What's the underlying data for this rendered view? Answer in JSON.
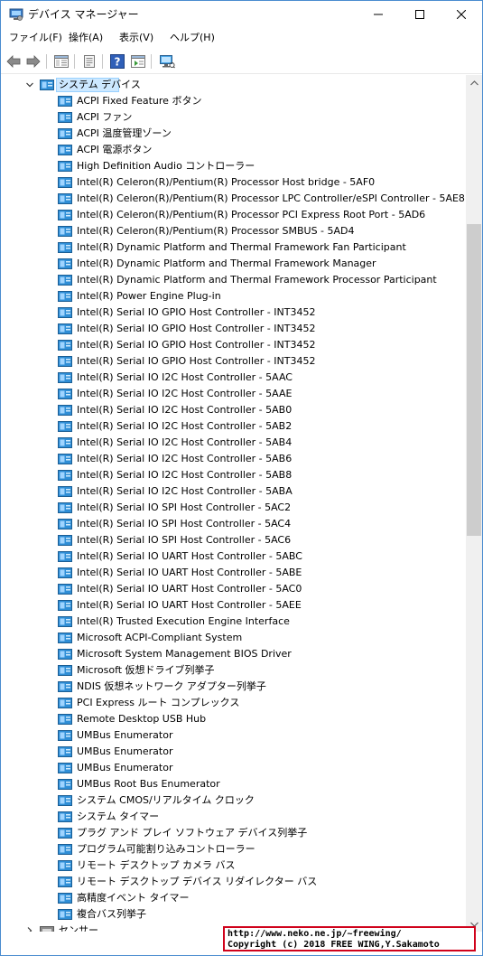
{
  "window": {
    "title": "デバイス マネージャー",
    "icon": "device-manager-icon"
  },
  "menu": [
    {
      "label": "ファイル(F)"
    },
    {
      "label": "操作(A)"
    },
    {
      "label": "表示(V)"
    },
    {
      "label": "ヘルプ(H)"
    }
  ],
  "toolbar": [
    {
      "name": "back-button",
      "icon": "arrow-left-icon"
    },
    {
      "name": "forward-button",
      "icon": "arrow-right-icon"
    },
    {
      "name": "show-hide-console-tree-button",
      "icon": "console-tree-icon"
    },
    {
      "name": "properties-button",
      "icon": "properties-icon"
    },
    {
      "name": "help-button",
      "icon": "help-icon"
    },
    {
      "name": "action-pane-button",
      "icon": "action-pane-icon"
    },
    {
      "name": "scan-hardware-button",
      "icon": "monitor-icon"
    }
  ],
  "tree": {
    "category": {
      "label": "システム デバイス",
      "expanded": true
    },
    "devices": [
      "ACPI Fixed Feature ボタン",
      "ACPI ファン",
      "ACPI 温度管理ゾーン",
      "ACPI 電源ボタン",
      "High Definition Audio コントローラー",
      "Intel(R) Celeron(R)/Pentium(R) Processor Host bridge - 5AF0",
      "Intel(R) Celeron(R)/Pentium(R) Processor LPC Controller/eSPI Controller - 5AE8",
      "Intel(R) Celeron(R)/Pentium(R) Processor PCI Express Root Port - 5AD6",
      "Intel(R) Celeron(R)/Pentium(R) Processor SMBUS - 5AD4",
      "Intel(R) Dynamic Platform and Thermal Framework Fan Participant",
      "Intel(R) Dynamic Platform and Thermal Framework Manager",
      "Intel(R) Dynamic Platform and Thermal Framework Processor Participant",
      "Intel(R) Power Engine Plug-in",
      "Intel(R) Serial IO GPIO Host Controller - INT3452",
      "Intel(R) Serial IO GPIO Host Controller - INT3452",
      "Intel(R) Serial IO GPIO Host Controller - INT3452",
      "Intel(R) Serial IO GPIO Host Controller - INT3452",
      "Intel(R) Serial IO I2C Host Controller - 5AAC",
      "Intel(R) Serial IO I2C Host Controller - 5AAE",
      "Intel(R) Serial IO I2C Host Controller - 5AB0",
      "Intel(R) Serial IO I2C Host Controller - 5AB2",
      "Intel(R) Serial IO I2C Host Controller - 5AB4",
      "Intel(R) Serial IO I2C Host Controller - 5AB6",
      "Intel(R) Serial IO I2C Host Controller - 5AB8",
      "Intel(R) Serial IO I2C Host Controller - 5ABA",
      "Intel(R) Serial IO SPI Host Controller - 5AC2",
      "Intel(R) Serial IO SPI Host Controller - 5AC4",
      "Intel(R) Serial IO SPI Host Controller - 5AC6",
      "Intel(R) Serial IO UART Host Controller - 5ABC",
      "Intel(R) Serial IO UART Host Controller - 5ABE",
      "Intel(R) Serial IO UART Host Controller - 5AC0",
      "Intel(R) Serial IO UART Host Controller - 5AEE",
      "Intel(R) Trusted Execution Engine Interface",
      "Microsoft ACPI-Compliant System",
      "Microsoft System Management BIOS Driver",
      "Microsoft 仮想ドライブ列挙子",
      "NDIS 仮想ネットワーク アダプター列挙子",
      "PCI Express ルート コンプレックス",
      "Remote Desktop USB Hub",
      "UMBus Enumerator",
      "UMBus Enumerator",
      "UMBus Enumerator",
      "UMBus Root Bus Enumerator",
      "システム CMOS/リアルタイム クロック",
      "システム タイマー",
      "プラグ アンド プレイ ソフトウェア デバイス列挙子",
      "プログラム可能割り込みコントローラー",
      "リモート デスクトップ カメラ バス",
      "リモート デスクトップ デバイス リダイレクター バス",
      "高精度イベント タイマー",
      "複合バス列挙子"
    ],
    "next_category": {
      "label": "センサー",
      "expanded": false
    }
  },
  "watermark": {
    "line1": "http://www.neko.ne.jp/~freewing/",
    "line2": "Copyright (c) 2018 FREE WING,Y.Sakamoto"
  },
  "colors": {
    "selection_bg": "#cce8ff",
    "selection_border": "#99d1ff",
    "window_border": "#4a8ccf",
    "watermark_border": "#d0021b",
    "device_icon": "#2f8ed6"
  }
}
